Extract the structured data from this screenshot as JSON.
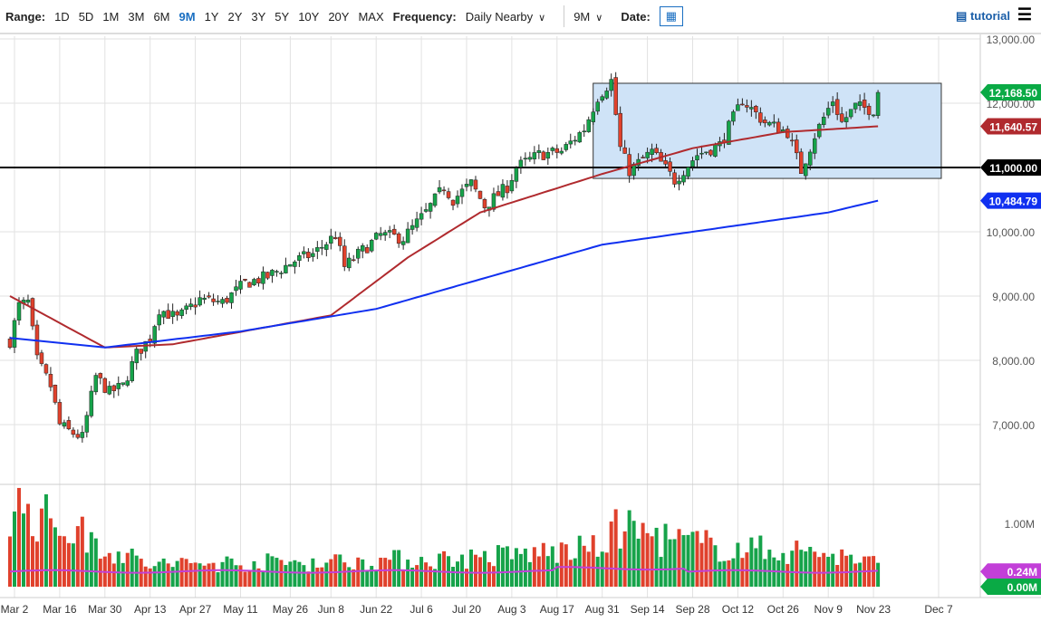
{
  "toolbar": {
    "range_label": "Range:",
    "ranges": [
      "1D",
      "5D",
      "1M",
      "3M",
      "6M",
      "9M",
      "1Y",
      "2Y",
      "3Y",
      "5Y",
      "10Y",
      "20Y",
      "MAX"
    ],
    "selected_range": "9M",
    "frequency_label": "Frequency:",
    "frequency": "Daily Nearby",
    "period": "9M",
    "date_label": "Date:",
    "tutorial": "tutorial"
  },
  "chart_data": {
    "type": "candlestick",
    "y_ticks": [
      7000,
      8000,
      9000,
      10000,
      11000,
      12000,
      13000
    ],
    "y_tick_labels": [
      "7,000.00",
      "8,000.00",
      "9,000.00",
      "10,000.00",
      "11,000.00",
      "12,000.00",
      "13,000.00"
    ],
    "ylim": [
      6200,
      13100
    ],
    "x_tick_labels": [
      "Mar 2",
      "Mar 16",
      "Mar 30",
      "Apr 13",
      "Apr 27",
      "May 11",
      "May 26",
      "Jun 8",
      "Jun 22",
      "Jul 6",
      "Jul 20",
      "Aug 3",
      "Aug 17",
      "Aug 31",
      "Sep 14",
      "Sep 28",
      "Oct 12",
      "Oct 26",
      "Nov 9",
      "Nov 23",
      "Dec 7"
    ],
    "x_tick_dates": [
      "2020-03-02",
      "2020-03-16",
      "2020-03-30",
      "2020-04-13",
      "2020-04-27",
      "2020-05-11",
      "2020-05-26",
      "2020-06-08",
      "2020-06-22",
      "2020-07-06",
      "2020-07-20",
      "2020-08-03",
      "2020-08-17",
      "2020-08-31",
      "2020-09-14",
      "2020-09-28",
      "2020-10-12",
      "2020-10-26",
      "2020-11-09",
      "2020-11-23",
      "2020-12-07"
    ],
    "close_anchors": [
      [
        "2020-02-28",
        8300
      ],
      [
        "2020-03-03",
        8850
      ],
      [
        "2020-03-05",
        8900
      ],
      [
        "2020-03-09",
        8000
      ],
      [
        "2020-03-12",
        7600
      ],
      [
        "2020-03-16",
        7000
      ],
      [
        "2020-03-18",
        6900
      ],
      [
        "2020-03-23",
        6800
      ],
      [
        "2020-03-26",
        7750
      ],
      [
        "2020-03-31",
        7500
      ],
      [
        "2020-04-03",
        7600
      ],
      [
        "2020-04-08",
        8100
      ],
      [
        "2020-04-13",
        8350
      ],
      [
        "2020-04-15",
        8800
      ],
      [
        "2020-04-21",
        8650
      ],
      [
        "2020-04-28",
        8950
      ],
      [
        "2020-05-05",
        8900
      ],
      [
        "2020-05-12",
        9200
      ],
      [
        "2020-05-19",
        9300
      ],
      [
        "2020-05-27",
        9550
      ],
      [
        "2020-06-02",
        9650
      ],
      [
        "2020-06-09",
        9950
      ],
      [
        "2020-06-11",
        9450
      ],
      [
        "2020-06-16",
        9650
      ],
      [
        "2020-06-23",
        9950
      ],
      [
        "2020-06-30",
        9900
      ],
      [
        "2020-07-07",
        10300
      ],
      [
        "2020-07-13",
        10700
      ],
      [
        "2020-07-15",
        10500
      ],
      [
        "2020-07-21",
        10750
      ],
      [
        "2020-07-24",
        10400
      ],
      [
        "2020-07-31",
        10700
      ],
      [
        "2020-08-04",
        11000
      ],
      [
        "2020-08-11",
        11200
      ],
      [
        "2020-08-18",
        11250
      ],
      [
        "2020-08-25",
        11600
      ],
      [
        "2020-08-28",
        12100
      ],
      [
        "2020-09-02",
        12350
      ],
      [
        "2020-09-04",
        11300
      ],
      [
        "2020-09-08",
        10950
      ],
      [
        "2020-09-15",
        11250
      ],
      [
        "2020-09-22",
        10800
      ],
      [
        "2020-09-29",
        11200
      ],
      [
        "2020-10-06",
        11350
      ],
      [
        "2020-10-13",
        12050
      ],
      [
        "2020-10-20",
        11700
      ],
      [
        "2020-10-27",
        11550
      ],
      [
        "2020-10-30",
        10950
      ],
      [
        "2020-11-04",
        11500
      ],
      [
        "2020-11-10",
        12050
      ],
      [
        "2020-11-12",
        11700
      ],
      [
        "2020-11-17",
        11950
      ],
      [
        "2020-11-23",
        11900
      ],
      [
        "2020-11-24",
        12168.5
      ]
    ],
    "ma50_anchors": [
      [
        "2020-02-28",
        9000
      ],
      [
        "2020-03-30",
        8200
      ],
      [
        "2020-04-20",
        8250
      ],
      [
        "2020-06-08",
        8700
      ],
      [
        "2020-07-01",
        9600
      ],
      [
        "2020-07-23",
        10300
      ],
      [
        "2020-08-31",
        10900
      ],
      [
        "2020-09-28",
        11300
      ],
      [
        "2020-10-26",
        11550
      ],
      [
        "2020-11-24",
        11640.57
      ]
    ],
    "ma200_anchors": [
      [
        "2020-02-28",
        8350
      ],
      [
        "2020-03-30",
        8200
      ],
      [
        "2020-05-11",
        8450
      ],
      [
        "2020-06-22",
        8800
      ],
      [
        "2020-07-20",
        9200
      ],
      [
        "2020-08-31",
        9800
      ],
      [
        "2020-10-12",
        10100
      ],
      [
        "2020-11-09",
        10300
      ],
      [
        "2020-11-24",
        10484.79
      ]
    ],
    "range_box": {
      "start": "2020-08-31",
      "end": "2020-12-14",
      "high": 12310,
      "low": 10830
    },
    "horizontal_line": 11000,
    "price_labels": [
      {
        "text": "12,168.50",
        "value": 12168.5,
        "color": "#0aaa45"
      },
      {
        "text": "11,640.57",
        "value": 11640.57,
        "color": "#b02a2e"
      },
      {
        "text": "11,000.00",
        "value": 11000,
        "color": "#000000"
      },
      {
        "text": "10,484.79",
        "value": 10484.79,
        "color": "#1030f0"
      }
    ],
    "volume": {
      "tick_label": "1.00M",
      "tick_value": 1.0,
      "avg_label": "0.24M",
      "avg_value": 0.24,
      "zero_label": "0.00M",
      "avg_color": "#c23fd8",
      "anchors": [
        [
          "2020-02-28",
          1.3
        ],
        [
          "2020-03-20",
          0.85
        ],
        [
          "2020-04-10",
          0.35
        ],
        [
          "2020-06-10",
          0.4
        ],
        [
          "2020-07-20",
          0.45
        ],
        [
          "2020-08-28",
          0.6
        ],
        [
          "2020-09-04",
          0.95
        ],
        [
          "2020-09-20",
          0.75
        ],
        [
          "2020-10-10",
          0.6
        ],
        [
          "2020-11-05",
          0.55
        ],
        [
          "2020-11-24",
          0.35
        ]
      ]
    },
    "colors": {
      "up": "#16a34a",
      "down": "#e0412c",
      "grid": "#e2e2e2"
    }
  }
}
